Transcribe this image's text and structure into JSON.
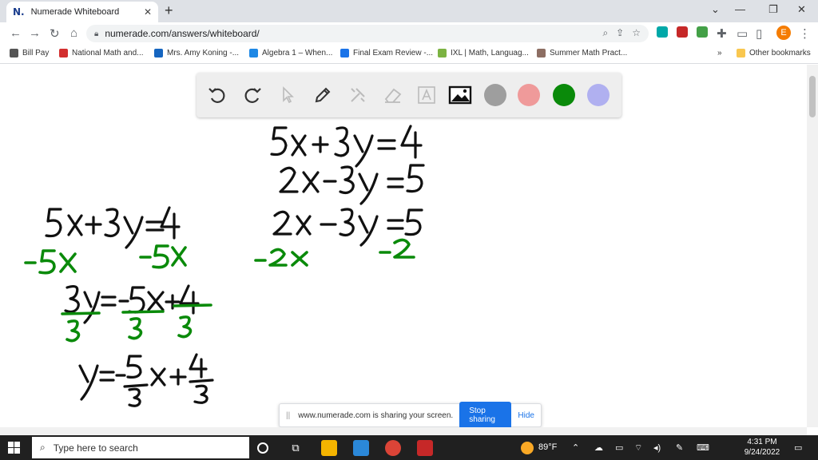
{
  "browser": {
    "tab_title": "Numerade Whiteboard",
    "tab_icon": "N.",
    "url": "numerade.com/answers/whiteboard/",
    "profile_initial": "E"
  },
  "bookmarks": [
    {
      "label": "Bill Pay",
      "color": "#555555"
    },
    {
      "label": "National Math and...",
      "color": "#d32f2f"
    },
    {
      "label": "Mrs. Amy Koning -...",
      "color": "#1565c0"
    },
    {
      "label": "Algebra 1 – When...",
      "color": "#1e88e5"
    },
    {
      "label": "Final Exam Review -...",
      "color": "#1a73e8"
    },
    {
      "label": "IXL | Math, Languag...",
      "color": "#7cb342"
    },
    {
      "label": "Summer Math Pract...",
      "color": "#8d6e63"
    }
  ],
  "bookmarks_more": "»",
  "other_bookmarks": "Other bookmarks",
  "toolbar_colors": {
    "gray": "#9e9e9e",
    "pink": "#ef9a9a",
    "green": "#0a8a0a",
    "lavender": "#b0b0f0"
  },
  "ink_colors": {
    "black": "#111111",
    "green": "#0a8a0a"
  },
  "share": {
    "message": "www.numerade.com is sharing your screen.",
    "stop": "Stop sharing",
    "hide": "Hide"
  },
  "taskbar": {
    "search_placeholder": "Type here to search",
    "weather": "89°F",
    "time": "4:31 PM",
    "date": "9/24/2022"
  }
}
